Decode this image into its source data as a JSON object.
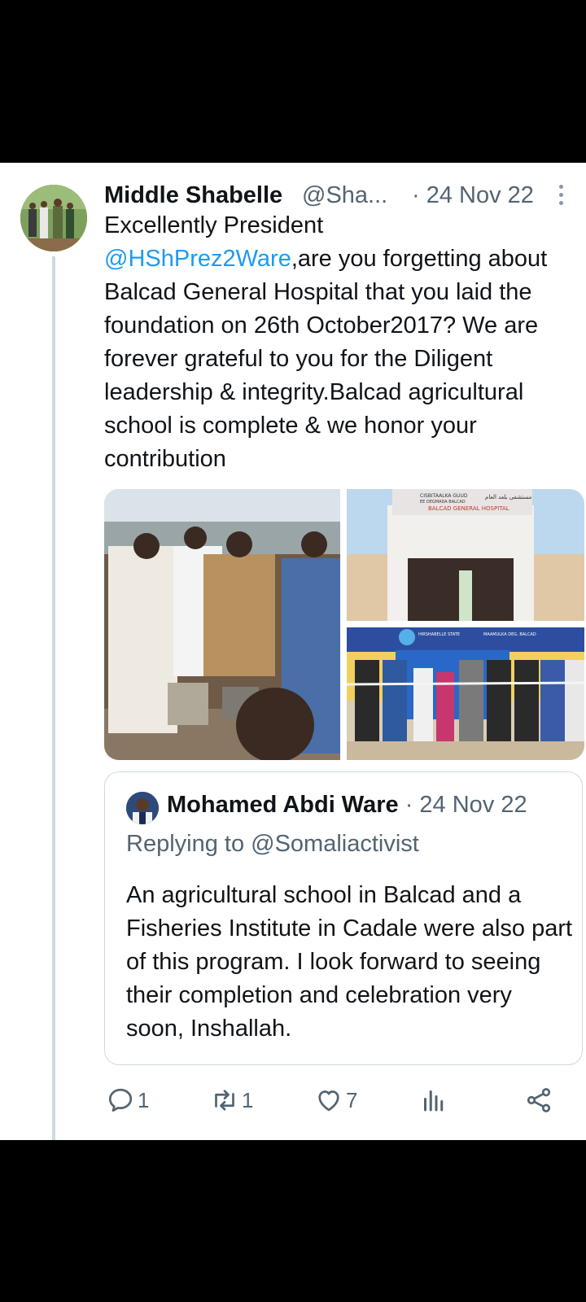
{
  "tweet": {
    "author_name": "Middle Shabelle",
    "author_handle": "@Sha...",
    "date": "· 24 Nov 22",
    "text_line1": "Excellently President",
    "mention": "@HShPrez2Ware",
    "text_rest": ",are you forgetting about Balcad General Hospital that you laid the foundation on 26th October2017? We  are forever grateful to you for the Diligent leadership & integrity.Balcad agricultural school is complete & we honor your contribution"
  },
  "media": {
    "image2_sign_line1": "CISBITAALKA GUUD",
    "image2_sign_line2": "EE DEGMADA BALCAD",
    "image2_sign_line3": "BALCAD GENERAL HOSPITAL",
    "image2_sign_arabic": "مستشفى بلعد العام",
    "image3_banner_left": "HIRSHABELLE STATE",
    "image3_banner_right": "MAAMULKA DEG. BALCAD"
  },
  "quote": {
    "author_name": "Mohamed Abdi Ware",
    "date": " · 24 Nov 22",
    "replying_to": "Replying to @Somaliactivist",
    "text": "An agricultural school in Balcad and a Fisheries Institute in Cadale were also part of this program. I look forward to seeing their completion and celebration very soon, Inshallah."
  },
  "actions": {
    "reply_count": "1",
    "retweet_count": "1",
    "like_count": "7",
    "icons": [
      "reply-icon",
      "retweet-icon",
      "like-icon",
      "views-icon",
      "share-icon"
    ]
  },
  "colors": {
    "text": "#0f1419",
    "secondary": "#536471",
    "link": "#1d9bf0",
    "border": "#cfd9de"
  }
}
